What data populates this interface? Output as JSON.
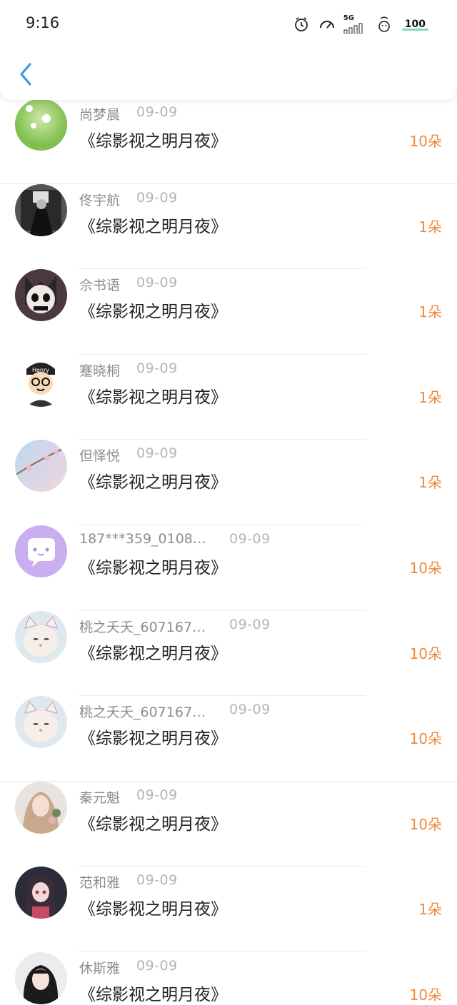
{
  "status_bar": {
    "time": "9:16",
    "network": "5G",
    "battery": "100"
  },
  "header": {
    "back_icon": "chevron-left-icon"
  },
  "colors": {
    "accent_orange": "#ee8a3e",
    "back_blue": "#3a9be0",
    "name_gray": "#8d8d8d",
    "date_gray": "#b5b5b5"
  },
  "items": [
    {
      "name": "尚梦晨",
      "date": "09-09",
      "title": "《综影视之明月夜》",
      "count": "10朵"
    },
    {
      "name": "佟宇航",
      "date": "09-09",
      "title": "《综影视之明月夜》",
      "count": "1朵"
    },
    {
      "name": "佘书语",
      "date": "09-09",
      "title": "《综影视之明月夜》",
      "count": "1朵"
    },
    {
      "name": "蹇晓桐",
      "date": "09-09",
      "title": "《综影视之明月夜》",
      "count": "1朵"
    },
    {
      "name": "但怿悦",
      "date": "09-09",
      "title": "《综影视之明月夜》",
      "count": "1朵"
    },
    {
      "name": "187***359_0108…",
      "date": "09-09",
      "title": "《综影视之明月夜》",
      "count": "10朵"
    },
    {
      "name": "桃之夭夭_607167…",
      "date": "09-09",
      "title": "《综影视之明月夜》",
      "count": "10朵"
    },
    {
      "name": "桃之夭夭_607167…",
      "date": "09-09",
      "title": "《综影视之明月夜》",
      "count": "10朵"
    },
    {
      "name": "秦元魁",
      "date": "09-09",
      "title": "《综影视之明月夜》",
      "count": "10朵"
    },
    {
      "name": "范和雅",
      "date": "09-09",
      "title": "《综影视之明月夜》",
      "count": "1朵"
    },
    {
      "name": "休斯雅",
      "date": "09-09",
      "title": "《综影视之明月夜》",
      "count": "10朵"
    }
  ]
}
